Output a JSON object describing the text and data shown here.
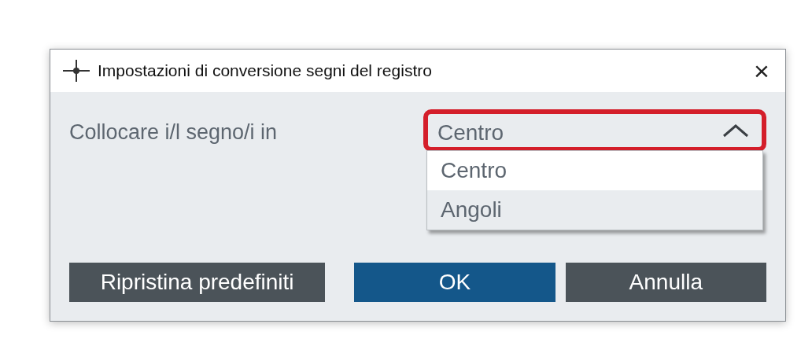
{
  "window": {
    "title": "Impostazioni di conversione segni del registro",
    "close": "×"
  },
  "field": {
    "label": "Collocare i/l segno/i in",
    "value": "Centro",
    "highlighted": true,
    "expanded": true,
    "options": [
      {
        "label": "Centro",
        "selected": true
      },
      {
        "label": "Angoli",
        "selected": false
      }
    ]
  },
  "buttons": [
    {
      "label": "Ripristina predefiniti",
      "kind": "secondary"
    },
    {
      "label": "OK",
      "kind": "primary"
    },
    {
      "label": "Annulla",
      "kind": "secondary"
    }
  ]
}
